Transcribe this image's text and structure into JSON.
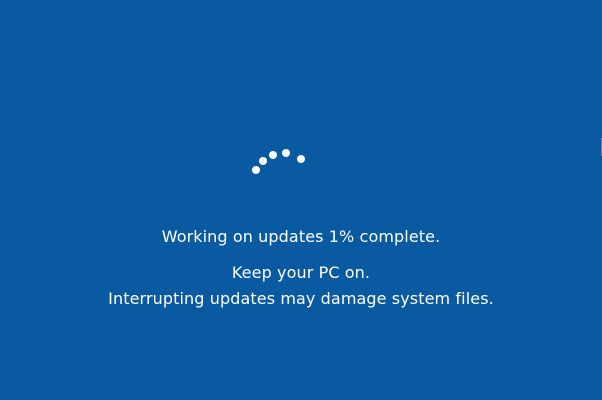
{
  "update_screen": {
    "progress_label": "Working on updates 1% complete.",
    "progress_percent": 1,
    "keep_on_label": "Keep your PC on.",
    "warning_label": "Interrupting updates may damage system files.",
    "spinner_icon": "loading-dots-icon"
  },
  "colors": {
    "background": "#0a5aa2",
    "text": "#ffffff"
  }
}
